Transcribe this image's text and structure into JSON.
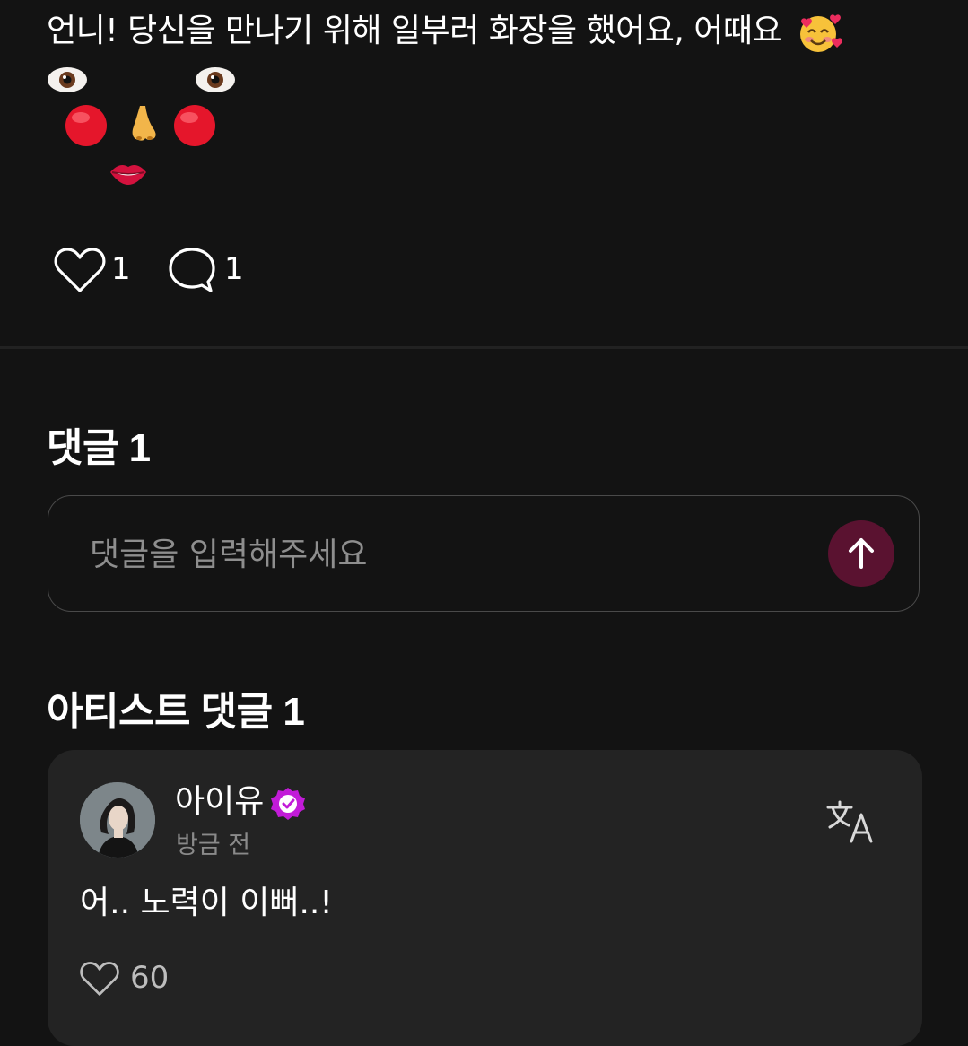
{
  "post": {
    "text": "언니! 당신을 만나기 위해 일부러 화장을 했어요, 어때요",
    "trailing_emoji": "smiling-face-with-hearts",
    "face_art": [
      "eye",
      "eye",
      "red-circle",
      "nose",
      "red-circle",
      "lips"
    ]
  },
  "actions": {
    "like_count": "1",
    "comment_count": "1"
  },
  "comments_section": {
    "title": "댓글 1",
    "input_placeholder": "댓글을 입력해주세요",
    "send_icon": "arrow-up-icon"
  },
  "artist_comments": {
    "title": "아티스트 댓글 1",
    "items": [
      {
        "author": "아이유",
        "verified": true,
        "time": "방금 전",
        "text": "어.. 노력이 이뻐..!",
        "like_count": "60"
      }
    ]
  },
  "colors": {
    "background": "#131313",
    "card": "#232323",
    "accent_verified": "#c21bd8",
    "send_button": "#5a1230",
    "muted_text": "#8a8a8a"
  }
}
